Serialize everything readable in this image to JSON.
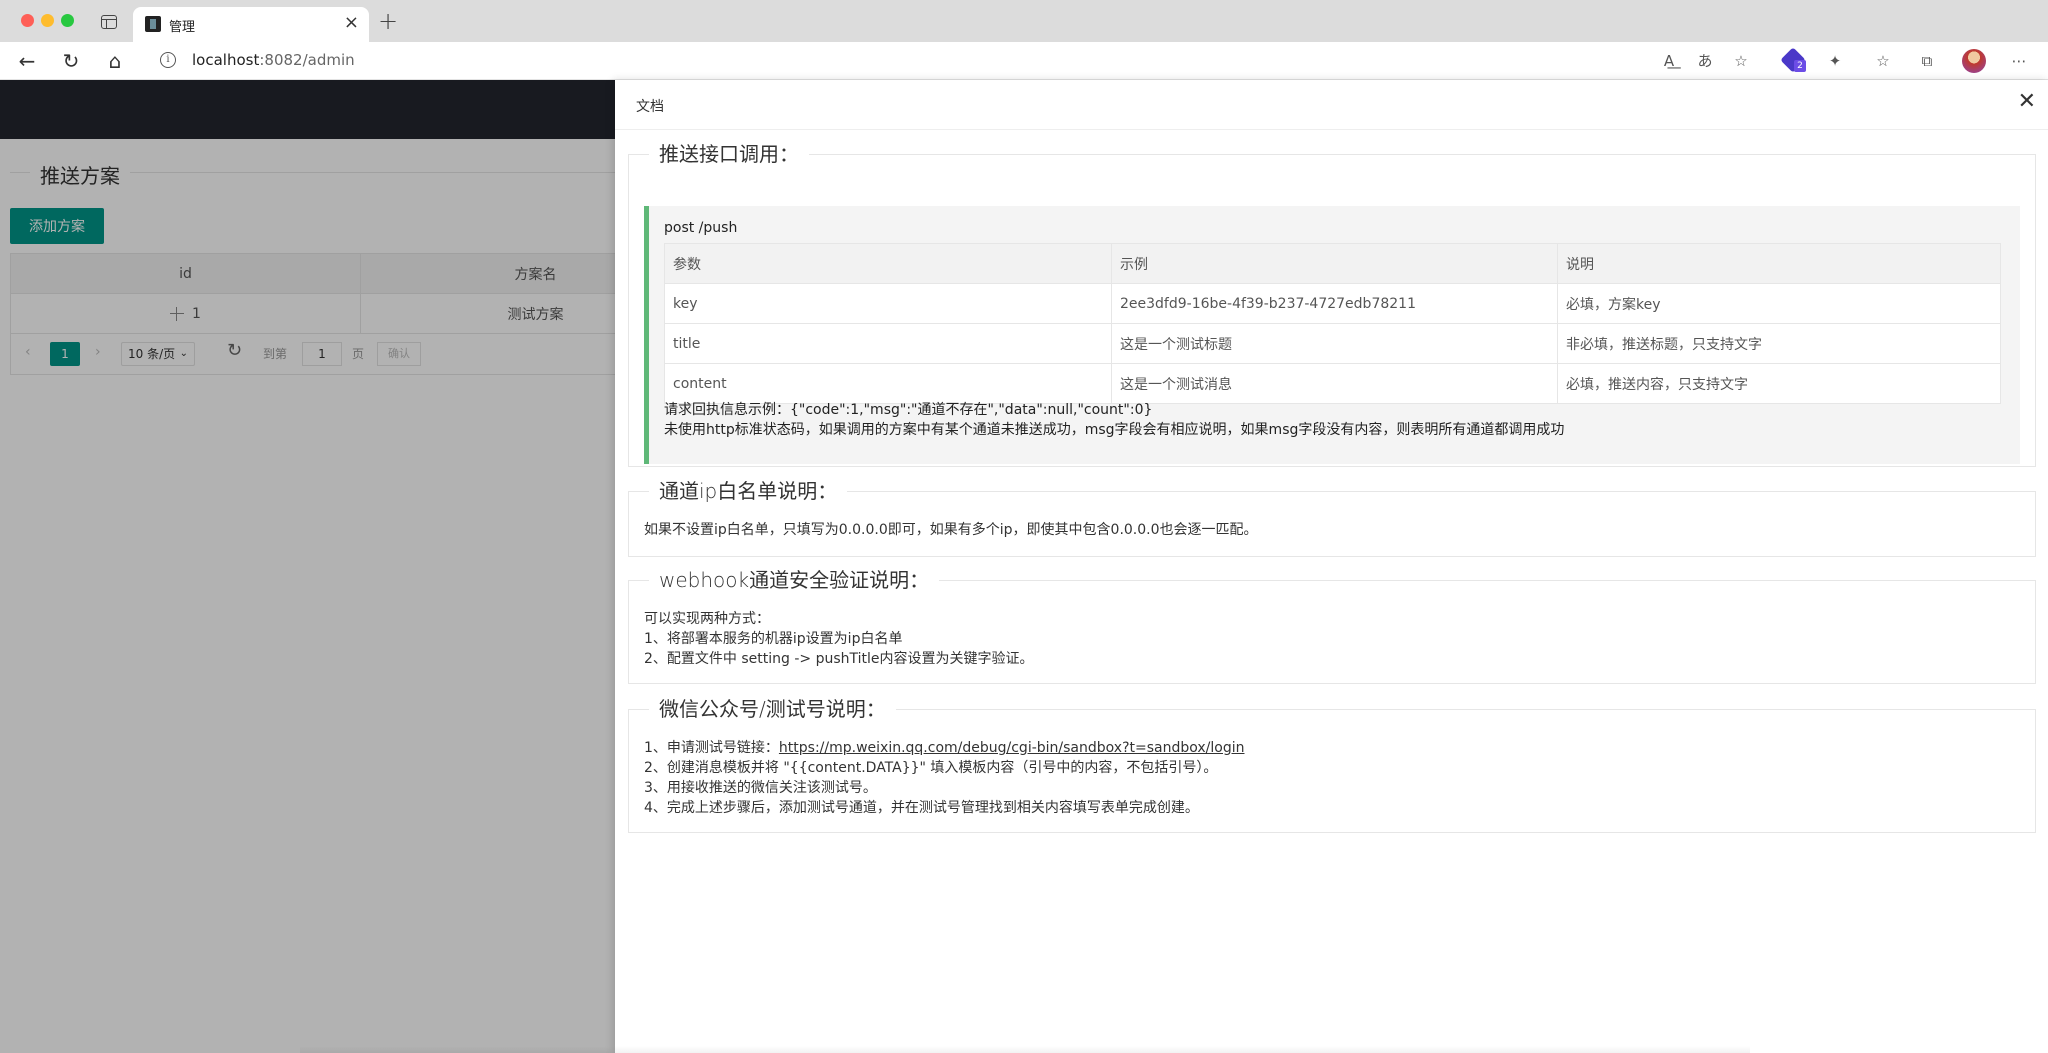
{
  "browser": {
    "tab_title": "管理",
    "url_host": "localhost",
    "url_rest": ":8082/admin",
    "toolbar_icons": [
      "read-aloud-icon",
      "translate-icon",
      "favorite-add-icon",
      "extension-icon",
      "puzzle-icon",
      "favorites-icon",
      "collections-icon",
      "profile-icon",
      "more-icon"
    ],
    "extension_badge": "2"
  },
  "page": {
    "section_title": "推送方案",
    "add_button": "添加方案",
    "table": {
      "headers": [
        "id",
        "方案名"
      ],
      "rows": [
        {
          "id": "1",
          "name": "测试方案"
        }
      ]
    },
    "pager": {
      "prev": "‹",
      "current": "1",
      "next": "›",
      "limit": "10 条/页",
      "goto_label": "到第",
      "goto_value": "1",
      "page_label": "页",
      "confirm": "确认"
    }
  },
  "drawer": {
    "title": "文档",
    "push": {
      "legend": "推送接口调用：",
      "api": "post /push",
      "headers": [
        "参数",
        "示例",
        "说明"
      ],
      "rows": [
        {
          "param": "key",
          "example": "2ee3dfd9-16be-4f39-b237-4727edb78211",
          "desc": "必填，方案key"
        },
        {
          "param": "title",
          "example": "这是一个测试标题",
          "desc": "非必填，推送标题，只支持文字"
        },
        {
          "param": "content",
          "example": "这是一个测试消息",
          "desc": "必填，推送内容，只支持文字"
        }
      ],
      "note1": "请求回执信息示例：{\"code\":1,\"msg\":\"通道不存在\",\"data\":null,\"count\":0}",
      "note2": "未使用http标准状态码，如果调用的方案中有某个通道未推送成功，msg字段会有相应说明，如果msg字段没有内容，则表明所有通道都调用成功"
    },
    "ip": {
      "legend": "通道ip白名单说明：",
      "text": "如果不设置ip白名单，只填写为0.0.0.0即可，如果有多个ip，即使其中包含0.0.0.0也会逐一匹配。"
    },
    "webhook": {
      "legend": "webhook通道安全验证说明：",
      "line1": "可以实现两种方式：",
      "line2": "1、将部署本服务的机器ip设置为ip白名单",
      "line3": "2、配置文件中 setting -> pushTitle内容设置为关键字验证。"
    },
    "wechat": {
      "legend": "微信公众号/测试号说明：",
      "line1_prefix": "1、申请测试号链接：",
      "line1_link": "https://mp.weixin.qq.com/debug/cgi-bin/sandbox?t=sandbox/login",
      "line2": "2、创建消息模板并将 \"{{content.DATA}}\" 填入模板内容（引号中的内容，不包括引号）。",
      "line3": "3、用接收推送的微信关注该测试号。",
      "line4": "4、完成上述步骤后，添加测试号通道，并在测试号管理找到相关内容填写表单完成创建。"
    }
  }
}
